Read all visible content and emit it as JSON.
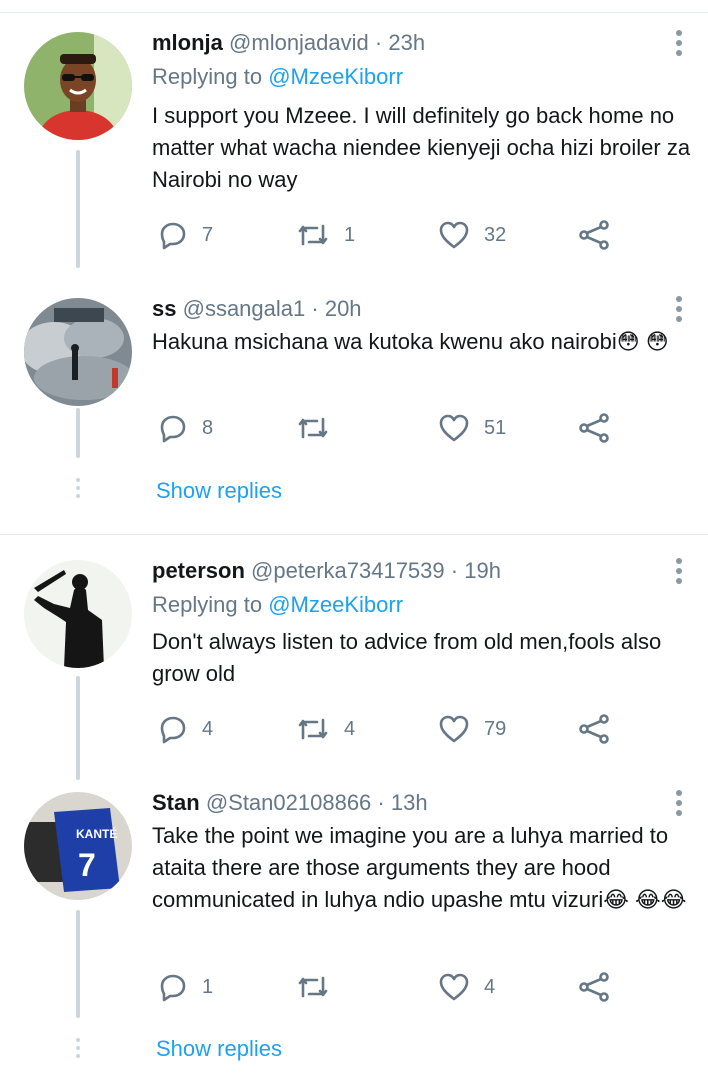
{
  "tweets": [
    {
      "name": "mlonja",
      "handle": "@mlonjadavid",
      "sep": "·",
      "time": "23h",
      "replying_prefix": "Replying to",
      "replying_to": "@MzeeKiborr",
      "text": "I support you Mzeee. I will definitely go back home no matter what wacha niendee kienyeji ocha hizi broiler za Nairobi no way",
      "replies": "7",
      "retweets": "1",
      "likes": "32"
    },
    {
      "name": "ss",
      "handle": "@ssangala1",
      "sep": "·",
      "time": "20h",
      "text": "Hakuna msichana wa kutoka kwenu ako nairobi😳 😳",
      "replies": "8",
      "retweets": "",
      "likes": "51"
    },
    {
      "name": "peterson",
      "handle": "@peterka73417539",
      "sep": "·",
      "time": "19h",
      "replying_prefix": "Replying to",
      "replying_to": "@MzeeKiborr",
      "text": "Don't always listen to advice from old men,fools also grow old",
      "replies": "4",
      "retweets": "4",
      "likes": "79"
    },
    {
      "name": "Stan",
      "handle": "@Stan02108866",
      "sep": "·",
      "time": "13h",
      "text": "Take the point we imagine you are a luhya married to ataita there are those arguments they are hood communicated in luhya ndio upashe mtu vizuri😂 😂😂",
      "replies": "1",
      "retweets": "",
      "likes": "4"
    }
  ],
  "show_replies_label": "Show replies",
  "colors": {
    "link": "#1da1f2",
    "muted": "#657786",
    "text": "#14171a",
    "line": "#ccd6dd"
  },
  "icons": {
    "reply": "reply-icon",
    "retweet": "retweet-icon",
    "like": "heart-icon",
    "share": "share-icon",
    "more": "more-vertical-icon"
  }
}
